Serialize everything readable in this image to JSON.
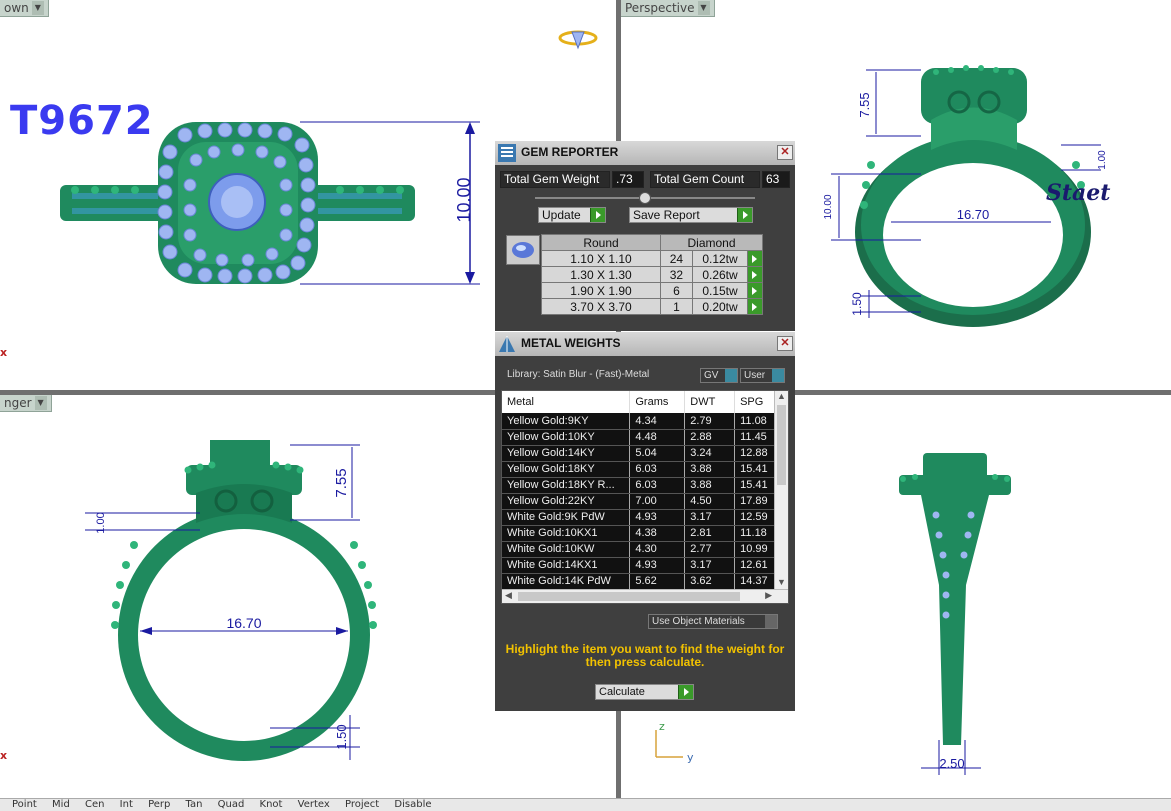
{
  "viewports": {
    "top_left": {
      "label": "own",
      "title_text": "T9672",
      "dimension": "10.00"
    },
    "top_right": {
      "label": "Perspective",
      "dims": [
        "7.55",
        "1.00",
        "10.00",
        "16.70",
        "1.50"
      ],
      "engraving": "Staet"
    },
    "bottom_left": {
      "label": "nger",
      "dims": [
        "7.55",
        "1.00",
        "16.70",
        "1.50"
      ]
    },
    "bottom_right": {
      "dims": [
        "2.50"
      ],
      "axis_z": "z",
      "axis_y": "y"
    },
    "axis_marker": "x"
  },
  "gem_reporter": {
    "title": "GEM REPORTER",
    "total_weight_label": "Total Gem Weight",
    "total_weight_value": ".73",
    "total_count_label": "Total Gem Count",
    "total_count_value": "63",
    "update_label": "Update",
    "save_report_label": "Save Report",
    "table": {
      "headers": [
        "Round",
        "Diamond"
      ],
      "rows": [
        {
          "size": "1.10 X 1.10",
          "count": "24",
          "weight": "0.12tw"
        },
        {
          "size": "1.30 X 1.30",
          "count": "32",
          "weight": "0.26tw"
        },
        {
          "size": "1.90 X 1.90",
          "count": "6",
          "weight": "0.15tw"
        },
        {
          "size": "3.70 X 3.70",
          "count": "1",
          "weight": "0.20tw"
        }
      ]
    }
  },
  "metal_weights": {
    "title": "METAL WEIGHTS",
    "library": "Library: Satin Blur - (Fast)-Metal",
    "toggle_gv": "GV",
    "toggle_user": "User",
    "columns": [
      "Metal",
      "Grams",
      "DWT",
      "SPG"
    ],
    "rows": [
      [
        "Yellow Gold:9KY",
        "4.34",
        "2.79",
        "11.08"
      ],
      [
        "Yellow Gold:10KY",
        "4.48",
        "2.88",
        "11.45"
      ],
      [
        "Yellow Gold:14KY",
        "5.04",
        "3.24",
        "12.88"
      ],
      [
        "Yellow Gold:18KY",
        "6.03",
        "3.88",
        "15.41"
      ],
      [
        "Yellow Gold:18KY R...",
        "6.03",
        "3.88",
        "15.41"
      ],
      [
        "Yellow Gold:22KY",
        "7.00",
        "4.50",
        "17.89"
      ],
      [
        "White Gold:9K PdW",
        "4.93",
        "3.17",
        "12.59"
      ],
      [
        "White Gold:10KX1",
        "4.38",
        "2.81",
        "11.18"
      ],
      [
        "White Gold:10KW",
        "4.30",
        "2.77",
        "10.99"
      ],
      [
        "White Gold:14KX1",
        "4.93",
        "3.17",
        "12.61"
      ],
      [
        "White Gold:14K PdW",
        "5.62",
        "3.62",
        "14.37"
      ]
    ],
    "use_object_materials": "Use Object Materials",
    "hint": "Highlight the item you want to find the weight for then press calculate.",
    "calculate_label": "Calculate"
  },
  "statusbar": {
    "items": [
      "Point",
      "Mid",
      "Cen",
      "Int",
      "Perp",
      "Tan",
      "Quad",
      "Knot",
      "Vertex",
      "Project",
      "Disable"
    ]
  },
  "colors": {
    "metal": "#1f8a5e",
    "gem": "#8fa9f0",
    "dimension": "#1a1aa0",
    "title": "#3a3af0"
  }
}
